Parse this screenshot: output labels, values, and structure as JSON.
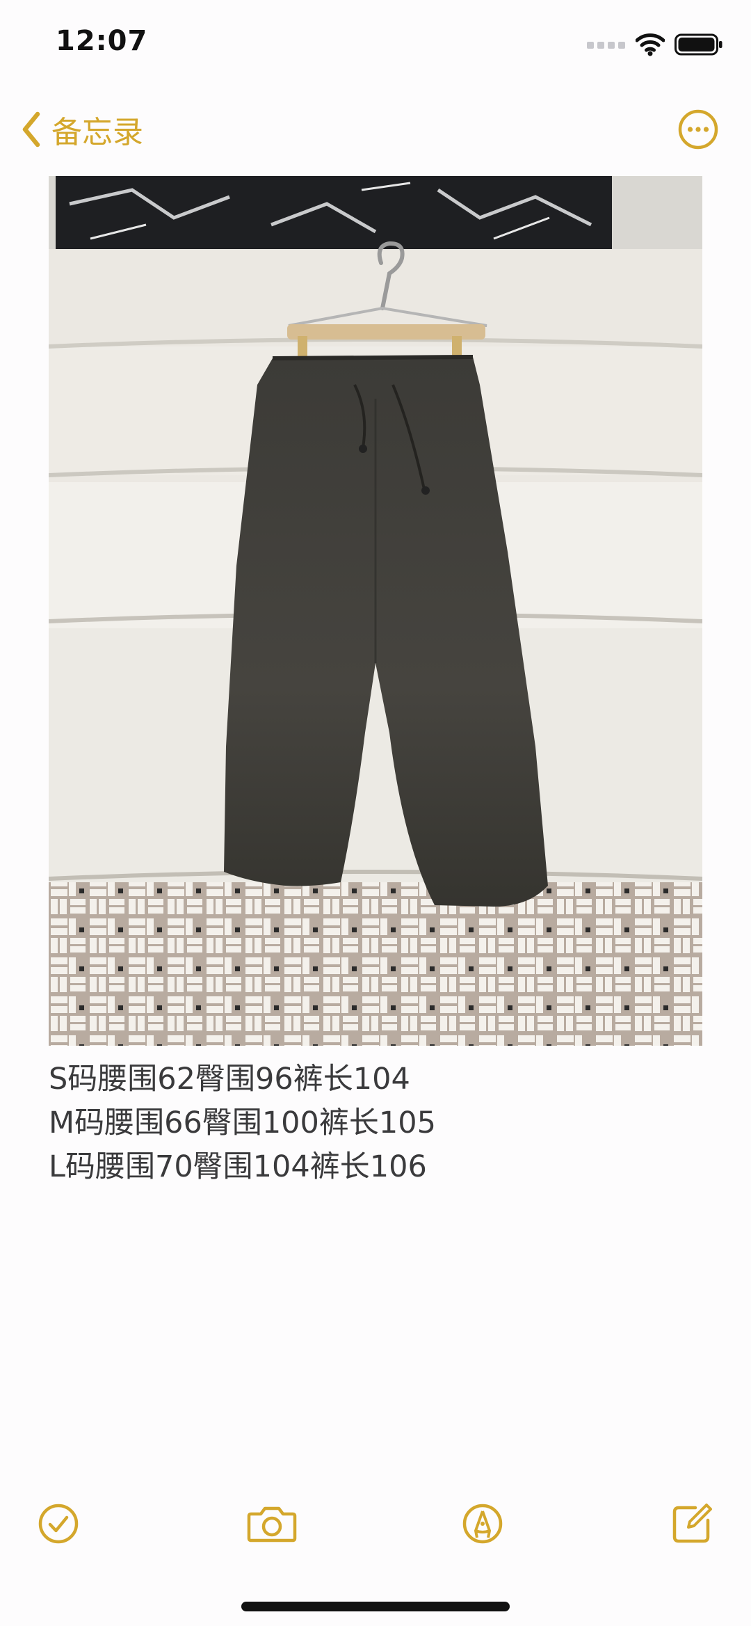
{
  "status_bar": {
    "time": "12:07"
  },
  "nav": {
    "back_label": "备忘录",
    "back_icon": "chevron-left-icon",
    "more_icon": "ellipsis-circle-icon"
  },
  "note": {
    "image_description_icon": "photo",
    "lines": [
      "S码腰围62臀围96裤长104",
      "M码腰围66臀围100裤长105",
      "L码腰围70臀围104裤长106"
    ]
  },
  "toolbar": {
    "checklist_icon": "checkmark-circle-icon",
    "camera_icon": "camera-icon",
    "markup_icon": "pen-tip-circle-icon",
    "compose_icon": "compose-icon"
  },
  "colors": {
    "accent": "#d4a72c",
    "background": "#fdfcfd",
    "text": "#3a3a3c"
  }
}
